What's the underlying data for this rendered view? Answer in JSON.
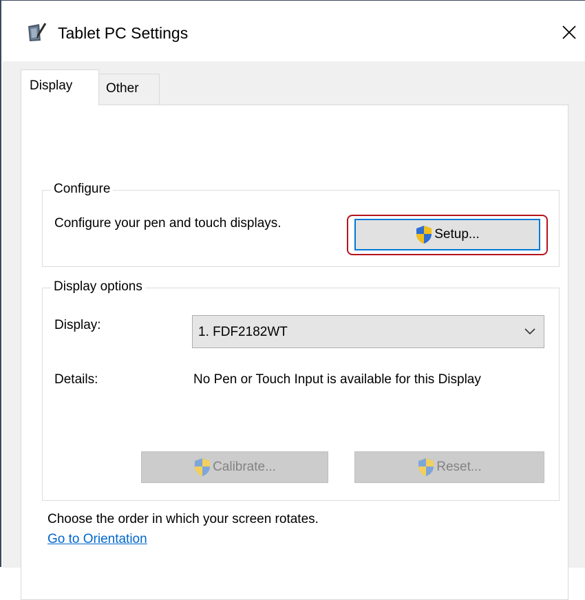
{
  "window": {
    "title": "Tablet PC Settings",
    "app_icon": "tablet-pen-icon",
    "close_icon": "close-icon"
  },
  "tabs": [
    {
      "label": "Display",
      "active": true
    },
    {
      "label": "Other",
      "active": false
    }
  ],
  "configure": {
    "caption": "Configure",
    "description": "Configure your pen and touch displays.",
    "setup_button": "Setup...",
    "setup_icon": "uac-shield-icon"
  },
  "display_options": {
    "caption": "Display options",
    "display_label": "Display:",
    "display_selected": "1. FDF2182WT",
    "details_label": "Details:",
    "details_value": "No Pen or Touch Input is available for this Display",
    "calibrate_button": "Calibrate...",
    "reset_button": "Reset..."
  },
  "orientation": {
    "text": "Choose the order in which your screen rotates.",
    "link": "Go to Orientation"
  },
  "colors": {
    "default_button_border": "#0078d7",
    "highlight_ring": "#b5131b",
    "link": "#0066cc",
    "disabled_text": "#838383"
  }
}
